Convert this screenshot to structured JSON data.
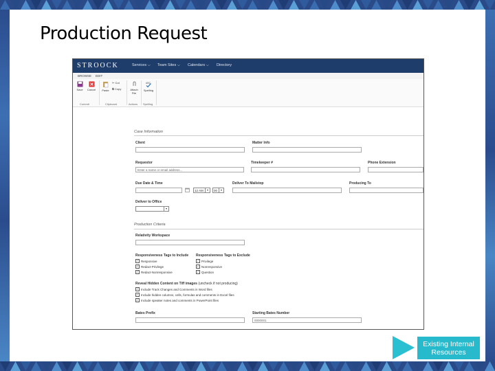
{
  "slide": {
    "title": "Production Request",
    "resources_button": "Existing Internal Resources"
  },
  "app": {
    "logo": "STROOCK",
    "nav": [
      "Services ⌵",
      "Team Sites ⌵",
      "Calendars ⌵",
      "Directory"
    ],
    "ribbon_tabs": [
      "BROWSE",
      "EDIT"
    ],
    "ribbon": {
      "save": "Save",
      "cancel": "Cancel",
      "paste": "Paste",
      "cut": "Cut",
      "copy": "Copy",
      "attach": "Attach File",
      "spelling": "Spelling",
      "groups": [
        "Commit",
        "Clipboard",
        "Actions",
        "Spelling"
      ]
    }
  },
  "form": {
    "case_section": "Case Information",
    "client_label": "Client",
    "matter_label": "Matter Info",
    "requestor_label": "Requestor",
    "requestor_placeholder": "Enter a name or email address...",
    "timekeeper_label": "Timekeeper #",
    "phone_label": "Phone Extension",
    "due_label": "Due Date & Time",
    "due_hour": "12 AM",
    "due_min": "00",
    "deliver_mailstop_label": "Deliver To Mailstop",
    "producing_label": "Producing To",
    "deliver_office_label": "Deliver to Office",
    "criteria_section": "Production Criteria",
    "relativity_label": "Relativity Workspace",
    "tags_include_label": "Responsiveness Tags to Include",
    "tags_include": [
      "Responsive",
      "Redact-Privilege",
      "Redact-Nonresponsive"
    ],
    "tags_exclude_label": "Responsiveness Tags to Exclude",
    "tags_exclude": [
      "Privilege",
      "Nonresponsive",
      "Question"
    ],
    "reveal_label": "Reveal Hidden Content on Tiff images",
    "reveal_note": "(uncheck if not producing)",
    "reveal_items": [
      "Include Track Changes and Comments in Word files",
      "Include hidden columns, cells, formulas and comments in Excel files",
      "Include speaker notes and comments in PowerPoint files"
    ],
    "bates_prefix_label": "Bates Prefix",
    "starting_bates_label": "Starting Bates Number",
    "starting_bates_value": "0000001"
  },
  "colors": {
    "nav_bg": "#1f3d6b",
    "accent_teal": "#27b9cc",
    "frame_blue": "#1f3c74"
  }
}
